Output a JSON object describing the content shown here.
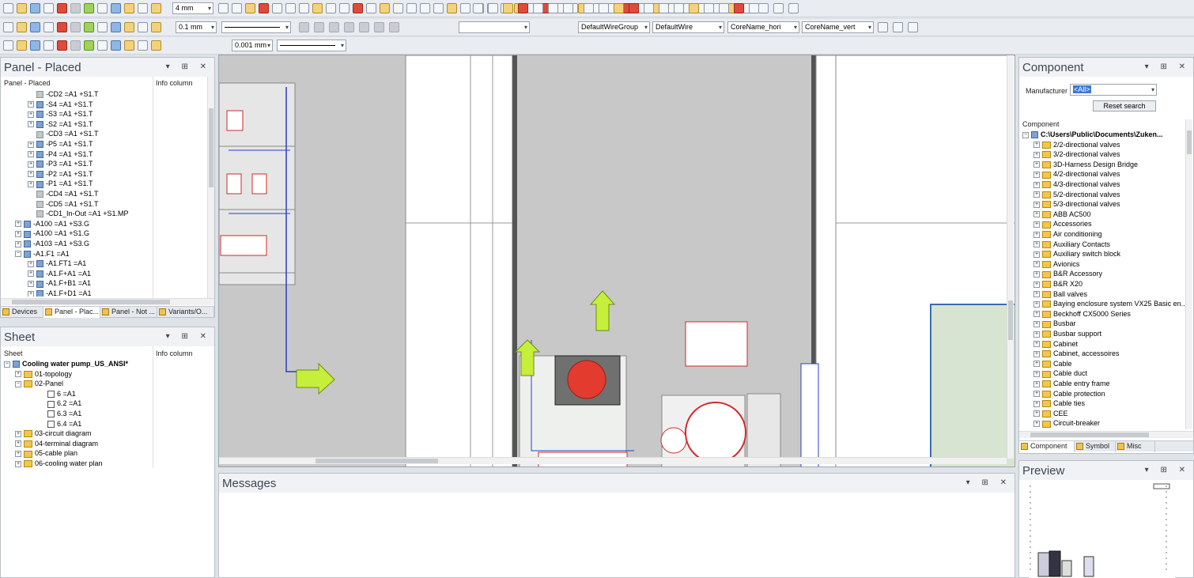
{
  "toolbar": {
    "grid_size": "4 mm",
    "line_width": "0.1 mm",
    "tolerance": "0.001 mm",
    "empty_select": "",
    "wire_group": "DefaultWireGroup",
    "wire": "DefaultWire",
    "core_hori": "CoreName_hori",
    "core_vert": "CoreName_vert"
  },
  "panel_placed": {
    "title": "Panel - Placed",
    "col1": "Panel - Placed",
    "col2": "Info column",
    "items": [
      {
        "label": "-CD2 =A1 +S1.T",
        "exp": "",
        "icon": "box"
      },
      {
        "label": "-S4 =A1 +S1.T",
        "exp": "+",
        "icon": "dev"
      },
      {
        "label": "-S3 =A1 +S1.T",
        "exp": "+",
        "icon": "dev"
      },
      {
        "label": "-S2 =A1 +S1.T",
        "exp": "+",
        "icon": "dev"
      },
      {
        "label": "-CD3 =A1 +S1.T",
        "exp": "",
        "icon": "box"
      },
      {
        "label": "-P5 =A1 +S1.T",
        "exp": "+",
        "icon": "dev"
      },
      {
        "label": "-P4 =A1 +S1.T",
        "exp": "+",
        "icon": "dev"
      },
      {
        "label": "-P3 =A1 +S1.T",
        "exp": "+",
        "icon": "dev"
      },
      {
        "label": "-P2 =A1 +S1.T",
        "exp": "+",
        "icon": "dev"
      },
      {
        "label": "-P1 =A1 +S1.T",
        "exp": "+",
        "icon": "dev"
      },
      {
        "label": "-CD4 =A1 +S1.T",
        "exp": "",
        "icon": "box"
      },
      {
        "label": "-CD5 =A1 +S1.T",
        "exp": "",
        "icon": "box"
      },
      {
        "label": "-CD1_In-Out =A1 +S1.MP",
        "exp": "",
        "icon": "box"
      },
      {
        "label": "-A100 =A1 +S3.G",
        "exp": "+",
        "icon": "dev"
      },
      {
        "label": "-A100 =A1 +S1.G",
        "exp": "+",
        "icon": "dev"
      },
      {
        "label": "-A103 =A1 +S3.G",
        "exp": "+",
        "icon": "dev"
      },
      {
        "label": "-A1.F1 =A1",
        "exp": "−",
        "icon": "dev"
      },
      {
        "label": "-A1.FT1 =A1",
        "exp": "+",
        "icon": "dev"
      },
      {
        "label": "-A1.F+A1 =A1",
        "exp": "+",
        "icon": "dev"
      },
      {
        "label": "-A1.F+B1 =A1",
        "exp": "+",
        "icon": "dev"
      },
      {
        "label": "-A1.F+D1 =A1",
        "exp": "+",
        "icon": "dev"
      }
    ],
    "tabs": [
      "Devices",
      "Panel - Plac...",
      "Panel - Not ...",
      "Variants/O..."
    ]
  },
  "sheet": {
    "title": "Sheet",
    "col1": "Sheet",
    "col2": "Info column",
    "items": [
      {
        "label": "Cooling water pump_US_ANSI*",
        "exp": "−",
        "icon": "dev",
        "bold": true
      },
      {
        "label": "01-topology",
        "exp": "+",
        "icon": "fold"
      },
      {
        "label": "02-Panel",
        "exp": "−",
        "icon": "fold"
      },
      {
        "label": "6 =A1",
        "exp": "",
        "icon": "chk"
      },
      {
        "label": "6.2 =A1",
        "exp": "",
        "icon": "chk"
      },
      {
        "label": "6.3 =A1",
        "exp": "",
        "icon": "chk"
      },
      {
        "label": "6.4 =A1",
        "exp": "",
        "icon": "chk"
      },
      {
        "label": "03-circuit diagram",
        "exp": "+",
        "icon": "fold"
      },
      {
        "label": "04-terminal diagram",
        "exp": "+",
        "icon": "fold"
      },
      {
        "label": "05-cable plan",
        "exp": "+",
        "icon": "fold"
      },
      {
        "label": "06-cooling water plan",
        "exp": "+",
        "icon": "fold"
      }
    ]
  },
  "messages": {
    "title": "Messages"
  },
  "component": {
    "title": "Component",
    "manufacturer_label": "Manufacturer",
    "manufacturer_value": "<All>",
    "reset_label": "Reset search",
    "col1": "Component",
    "root": "C:\\Users\\Public\\Documents\\Zuken...",
    "items": [
      "2/2-directional valves",
      "3/2-directional valves",
      "3D-Harness Design Bridge",
      "4/2-directional valves",
      "4/3-directional valves",
      "5/2-directional valves",
      "5/3-directional valves",
      "ABB AC500",
      "Accessories",
      "Air conditioning",
      "Auxiliary Contacts",
      "Auxiliary switch block",
      "Avionics",
      "B&R Accessory",
      "B&R X20",
      "Ball valves",
      "Baying enclosure system VX25 Basic en...",
      "Beckhoff CX5000 Series",
      "Busbar",
      "Busbar support",
      "Cabinet",
      "Cabinet, accessoires",
      "Cable",
      "Cable duct",
      "Cable entry frame",
      "Cable protection",
      "Cable ties",
      "CEE",
      "Circuit-breaker"
    ],
    "tabs": [
      "Component",
      "Symbol",
      "Misc"
    ]
  },
  "preview": {
    "title": "Preview"
  }
}
